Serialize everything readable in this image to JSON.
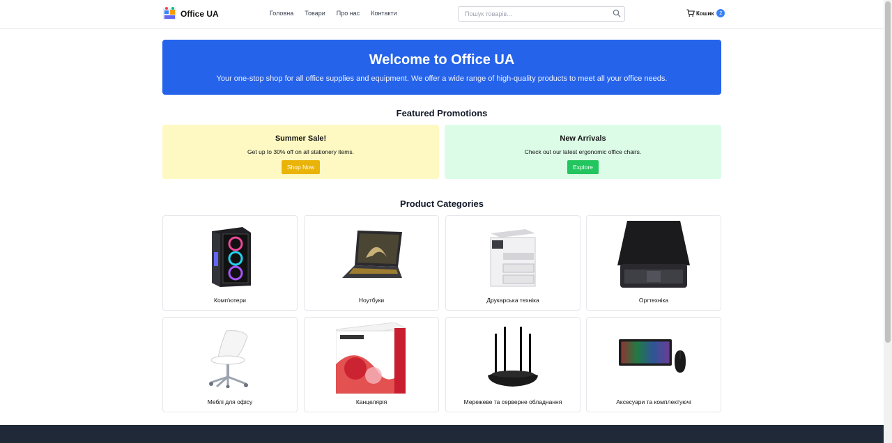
{
  "header": {
    "logo_text": "Office UA",
    "nav": [
      "Головна",
      "Товари",
      "Про нас",
      "Контакти"
    ],
    "search_placeholder": "Пошук товарів...",
    "cart_label": "Кошик",
    "cart_count": "2"
  },
  "hero": {
    "title": "Welcome to Office UA",
    "subtitle": "Your one-stop shop for all office supplies and equipment. We offer a wide range of high-quality products to meet all your office needs.",
    "color": "#2563eb"
  },
  "promotions": {
    "heading": "Featured Promotions",
    "items": [
      {
        "title": "Summer Sale!",
        "text": "Get up to 30% off on all stationery items.",
        "button": "Shop Now",
        "color": "#fef9c3"
      },
      {
        "title": "New Arrivals",
        "text": "Check out our latest ergonomic office chairs.",
        "button": "Explore",
        "color": "#dcfce7"
      }
    ]
  },
  "categories": {
    "heading": "Product Categories",
    "items": [
      {
        "label": "Комп'ютери",
        "icon": "computer-case-icon"
      },
      {
        "label": "Ноутбуки",
        "icon": "laptop-icon"
      },
      {
        "label": "Друкарська техніка",
        "icon": "printer-icon"
      },
      {
        "label": "Оргтехніка",
        "icon": "scanner-icon"
      },
      {
        "label": "Меблі для офісу",
        "icon": "office-chair-icon"
      },
      {
        "label": "Канцелярія",
        "icon": "paper-pack-icon"
      },
      {
        "label": "Мережеве та серверне обладнання",
        "icon": "router-icon"
      },
      {
        "label": "Аксесуари та комплектуючі",
        "icon": "keyboard-mouse-icon"
      }
    ]
  }
}
